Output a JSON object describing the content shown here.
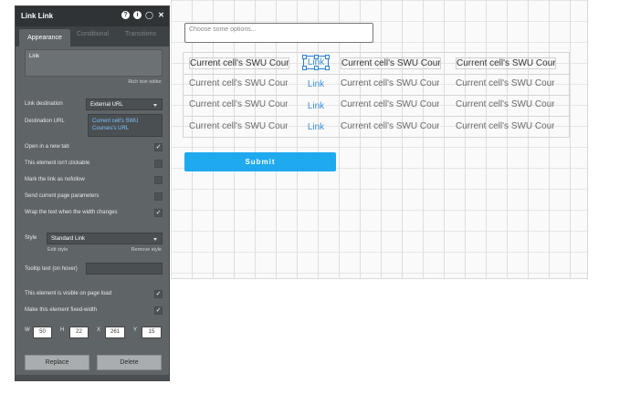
{
  "canvas": {
    "dropdown_placeholder": "Choose some options...",
    "rows": [
      {
        "col1": "Current cell's SWU Cour...",
        "link": "Link",
        "col3": "Current cell's SWU Cour...",
        "col4": "Current cell's SWU Cour..."
      },
      {
        "col1": "Current cell's SWU Cour...",
        "link": "Link",
        "col3": "Current cell's SWU Cour...",
        "col4": "Current cell's SWU Cour..."
      },
      {
        "col1": "Current cell's SWU Cour...",
        "link": "Link",
        "col3": "Current cell's SWU Cour...",
        "col4": "Current cell's SWU Cour..."
      },
      {
        "col1": "Current cell's SWU Cour...",
        "link": "Link",
        "col3": "Current cell's SWU Cour...",
        "col4": "Current cell's SWU Cour..."
      }
    ],
    "submit_label": "Submit",
    "colors": {
      "submit_bg": "#1fa9ef",
      "link": "#3a8fd8",
      "selection": "#2b7fd4"
    }
  },
  "panel": {
    "title": "Link Link",
    "header_icons": [
      "help-icon",
      "info-icon",
      "comment-icon",
      "close-icon"
    ],
    "tabs": [
      "Appearance",
      "Conditional",
      "Transitions"
    ],
    "link_text": "Link",
    "rich_text_editor": "Rich text editor",
    "link_destination_label": "Link destination",
    "link_destination_value": "External URL",
    "destination_url_label": "Destination URL",
    "destination_url_value": "Current cell's SWU Courses's URL",
    "checkboxes": [
      {
        "label": "Open in a new tab",
        "checked": true
      },
      {
        "label": "This element isn't clickable",
        "checked": false
      },
      {
        "label": "Mark the link as nofollow",
        "checked": false
      },
      {
        "label": "Send current page parameters",
        "checked": false
      },
      {
        "label": "Wrap the text when the width changes",
        "checked": true
      }
    ],
    "style_label": "Style",
    "style_value": "Standard Link",
    "edit_style": "Edit style",
    "remove_style": "Remove style",
    "tooltip_label": "Tooltip text (on hover)",
    "visible_label": "This element is visible on page load",
    "fixed_width_label": "Make this element fixed-width",
    "dims": {
      "w_label": "W",
      "w": "50",
      "h_label": "H",
      "h": "22",
      "x_label": "X",
      "x": "261",
      "y_label": "Y",
      "y": "15"
    },
    "replace_label": "Replace",
    "delete_label": "Delete",
    "colors": {
      "panel_bg": "#5f6467",
      "header_bg": "#2f3336",
      "url_text": "#7ec3ff"
    }
  }
}
